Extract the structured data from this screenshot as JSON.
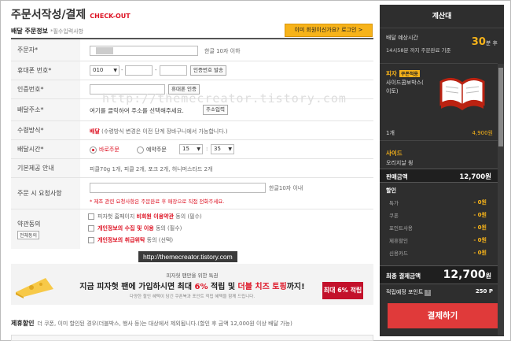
{
  "header": {
    "title": "주문서작성/결제",
    "subtitle": "CHECK-OUT"
  },
  "section": {
    "title": "배달 주문정보",
    "note": "*필수입력사항",
    "login_prompt": "이미 회원이신가요? 로그인 >"
  },
  "form": {
    "orderer": {
      "label": "주문자*",
      "value": "",
      "hint": "한글 10자 이하"
    },
    "phone": {
      "label": "휴대폰 번호*",
      "prefix": "010",
      "verify_button": "인증번호 발송"
    },
    "auth": {
      "label": "인증번호*",
      "button": "휴대폰 인증"
    },
    "address": {
      "label": "배달주소*",
      "text": "여기를 클릭하여 주소를 선택해주세요.",
      "button": "주소입력"
    },
    "receive": {
      "label": "수령방식*",
      "method": "배달",
      "note": "(수령방식 변경은 이전 단계 장바구니에서 가능합니다.)"
    },
    "time": {
      "label": "배달시간*",
      "option1": "바로주문",
      "option2": "예약주문",
      "hour": "15",
      "minute": "35"
    },
    "basic": {
      "label": "기본제공 안내",
      "text": "피클70g 1개, 피클 2개, 포크 2개, 허니머스타드 2개"
    },
    "request": {
      "label": "주문 시 요청사항",
      "hint": "한글10자 이내",
      "note": "* 제조 관련 요청사항은 주문완료 후 매장으로 직접 전화주세요."
    },
    "terms": {
      "label": "약관동의",
      "all_button": "전체동의",
      "items": [
        {
          "pre": "피자헛 홈페이지 ",
          "red": "비회원 이용약관",
          "post": " 동의 (필수)"
        },
        {
          "pre": "",
          "red": "개인정보의 수집 및 이용",
          "post": " 동의 (필수)"
        },
        {
          "pre": "",
          "red": "개인정보의 취급위탁",
          "post": " 동의 (선택)"
        }
      ]
    }
  },
  "watermark": "http://themecreator.tistory.com",
  "tooltip": "http://themecreator.tistory.com",
  "banner": {
    "line1": "피자헛 팬만을 위한 특권",
    "line2_a": "지금 피자헛 팬에 가입하시면 최대 ",
    "line2_b": "6%",
    "line2_c": " 적립 및 ",
    "line2_d": "더블 치즈 토핑",
    "line2_e": "까지!",
    "line3": "다양한 할인 혜택이 담긴 쿠폰북과 포인트 적립 혜택을 함께 드립니다.",
    "ticket": "최대 6% 적립"
  },
  "affiliate": {
    "title": "제휴할인",
    "text": "더 쿠폰, 이미 할인된 경우(더블박스, 행사 등)는 대상에서 제외됩니다.(할인 후 금액 12,000원 이상 배달 가능)"
  },
  "calc": {
    "title": "계산대",
    "delivery_label": "배달 예상시간",
    "delivery_sub": "14시58분 까지 주문완료 기준",
    "minutes": "30",
    "minutes_unit": "분 후",
    "pizza_cat": "피자",
    "coupon": "쿠폰적용",
    "pizza_name1": "사이드콤보박스(",
    "pizza_name2": "이토)",
    "qty": "1개",
    "price": "4,900원",
    "side_cat": "사이드",
    "side_name": "오리지날 윙",
    "sale_label": "판매금액",
    "sale_value": "12,700원",
    "discount_label": "할인",
    "discounts": [
      {
        "k": "특가",
        "v": "- 0원"
      },
      {
        "k": "쿠폰",
        "v": "- 0원"
      },
      {
        "k": "포인트사용",
        "v": "- 0원"
      },
      {
        "k": "제휴할인",
        "v": "- 0원"
      },
      {
        "k": "신용카드",
        "v": "- 0원"
      }
    ],
    "final_label": "최종 결제금액",
    "final_value": "12,700",
    "final_unit": "원",
    "points_label": "적립예정 포인트",
    "points_value": "250 P",
    "pay_button": "결제하기"
  }
}
